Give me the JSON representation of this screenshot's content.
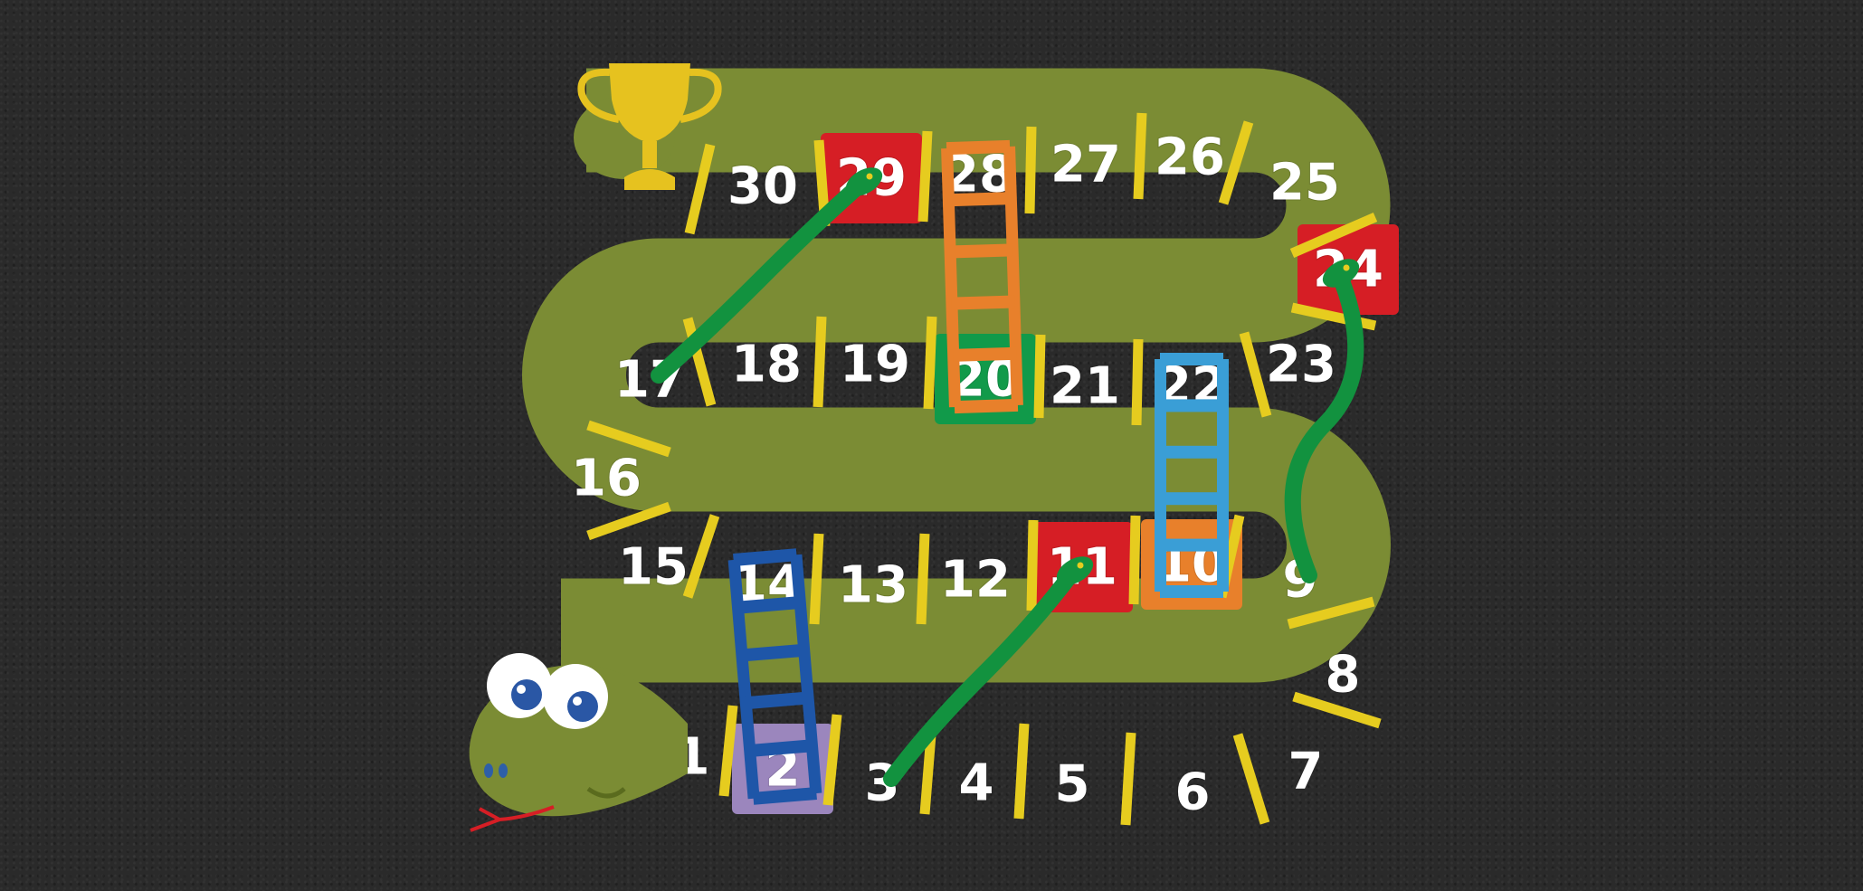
{
  "board": {
    "squares": [
      {
        "n": "1",
        "color": "#7b8c34"
      },
      {
        "n": "2",
        "color": "#9b86bd"
      },
      {
        "n": "3",
        "color": "#7b8c34"
      },
      {
        "n": "4",
        "color": "#7b8c34"
      },
      {
        "n": "5",
        "color": "#7b8c34"
      },
      {
        "n": "6",
        "color": "#7b8c34"
      },
      {
        "n": "7",
        "color": "#7b8c34"
      },
      {
        "n": "8",
        "color": "#7b8c34"
      },
      {
        "n": "9",
        "color": "#7b8c34"
      },
      {
        "n": "10",
        "color": "#e8802b"
      },
      {
        "n": "11",
        "color": "#d61e25"
      },
      {
        "n": "12",
        "color": "#7b8c34"
      },
      {
        "n": "13",
        "color": "#7b8c34"
      },
      {
        "n": "14",
        "color": "#7b8c34"
      },
      {
        "n": "15",
        "color": "#7b8c34"
      },
      {
        "n": "16",
        "color": "#7b8c34"
      },
      {
        "n": "17",
        "color": "#7b8c34"
      },
      {
        "n": "18",
        "color": "#7b8c34"
      },
      {
        "n": "19",
        "color": "#7b8c34"
      },
      {
        "n": "20",
        "color": "#119a4a"
      },
      {
        "n": "21",
        "color": "#7b8c34"
      },
      {
        "n": "22",
        "color": "#7b8c34"
      },
      {
        "n": "23",
        "color": "#7b8c34"
      },
      {
        "n": "24",
        "color": "#d61e25"
      },
      {
        "n": "25",
        "color": "#7b8c34"
      },
      {
        "n": "26",
        "color": "#7b8c34"
      },
      {
        "n": "27",
        "color": "#7b8c34"
      },
      {
        "n": "28",
        "color": "#7b8c34"
      },
      {
        "n": "29",
        "color": "#d61e25"
      },
      {
        "n": "30",
        "color": "#7b8c34"
      }
    ],
    "ladders": [
      {
        "from": "2",
        "to": "14",
        "color": "#1e56a8"
      },
      {
        "from": "10",
        "to": "22",
        "color": "#3a9ed6"
      },
      {
        "from": "20",
        "to": "28",
        "color": "#e8802b"
      }
    ],
    "snakes": [
      {
        "head": "29",
        "tail": "17",
        "color": "#12923f"
      },
      {
        "head": "24",
        "tail": "9",
        "color": "#12923f"
      },
      {
        "head": "11",
        "tail": "3",
        "color": "#12923f"
      }
    ],
    "colors": {
      "background": "#2a2a2a",
      "track": "#7b8c34",
      "divider": "#e6cc1f",
      "trophy": "#e6c21f",
      "snake_green": "#12923f"
    },
    "icons": [
      "trophy-icon",
      "snake-head-mascot"
    ]
  }
}
